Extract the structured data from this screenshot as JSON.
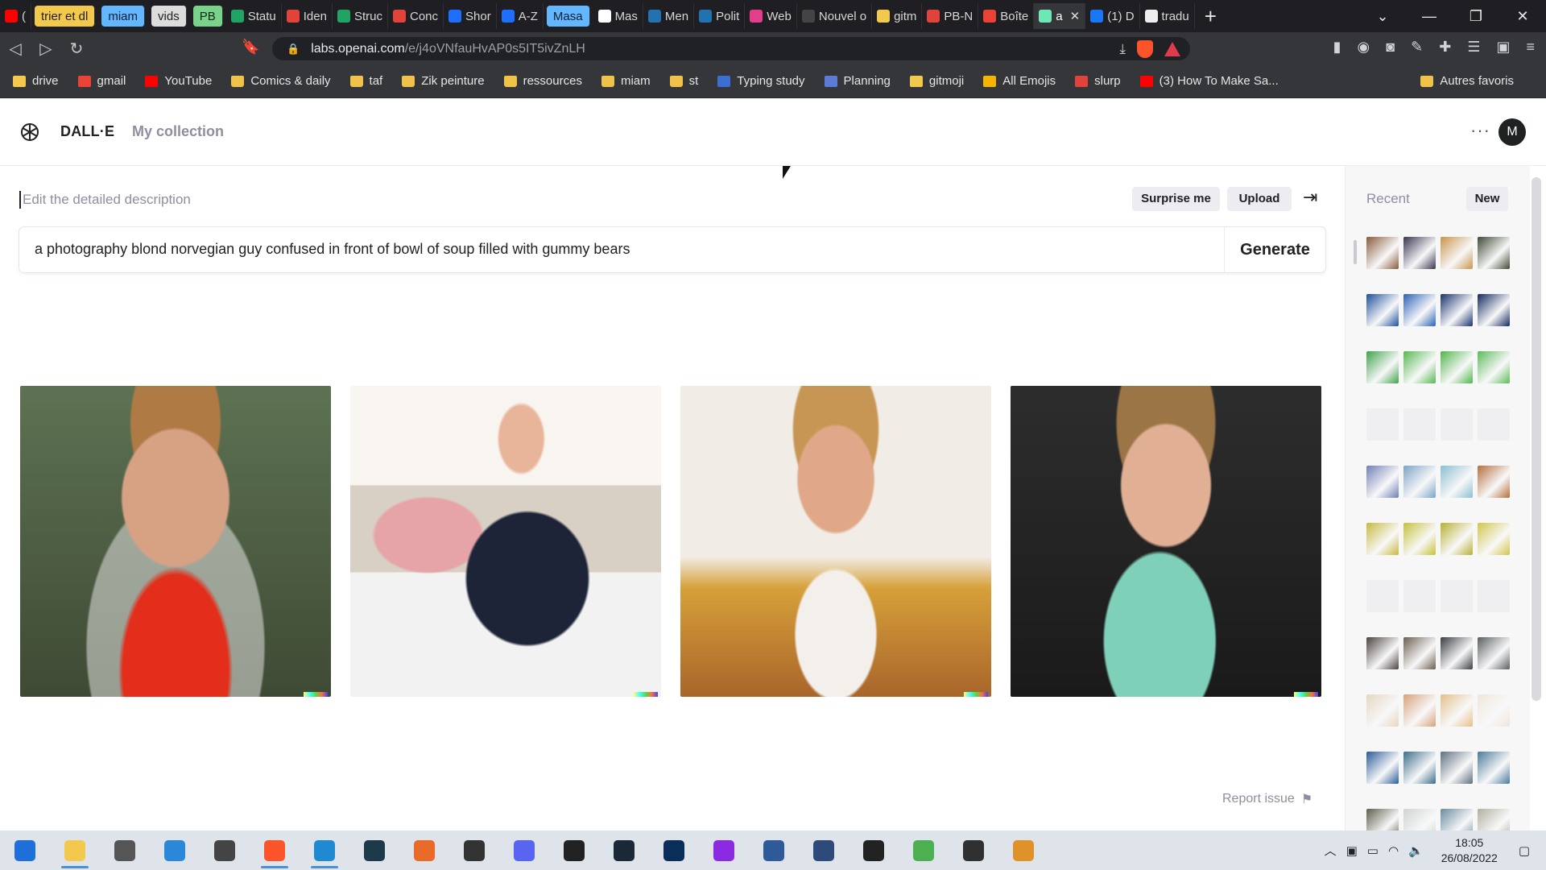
{
  "browser": {
    "tabs": [
      {
        "label": "(",
        "color": "#ff0000"
      },
      {
        "label": "trier et dl",
        "group": "yellow"
      },
      {
        "label": "miam",
        "group": "blue"
      },
      {
        "label": "vids",
        "group": "white"
      },
      {
        "label": "PB",
        "group": "green"
      },
      {
        "label": "Statu",
        "color": "#1fa463"
      },
      {
        "label": "Iden",
        "color": "#e0433a"
      },
      {
        "label": "Struc",
        "color": "#1fa463"
      },
      {
        "label": "Conc",
        "color": "#e0433a"
      },
      {
        "label": "Shor",
        "color": "#1e6fff"
      },
      {
        "label": "A-Z",
        "color": "#1e6fff"
      },
      {
        "label": "Masa",
        "group": "blue"
      },
      {
        "label": "Mas",
        "color": "#ffffff"
      },
      {
        "label": "Men",
        "color": "#2271b1"
      },
      {
        "label": "Polit",
        "color": "#2271b1"
      },
      {
        "label": "Web",
        "color": "#e33e8c"
      },
      {
        "label": "Nouvel o",
        "color": "#444"
      },
      {
        "label": "gitm",
        "color": "#f2c94c"
      },
      {
        "label": "PB-N",
        "color": "#e0433a"
      },
      {
        "label": "Boîte",
        "color": "#ea4335"
      },
      {
        "label": "a",
        "color": "#6ee7b7",
        "active": true
      },
      {
        "label": "(1) D",
        "color": "#1877f2"
      },
      {
        "label": "tradu",
        "color": "#eeeeee"
      }
    ],
    "url_host": "labs.openai.com",
    "url_path": "/e/j4oVNfauHvAP0s5IT5ivZnLH",
    "bookmarks": [
      {
        "label": "drive",
        "color": "#f2c94c"
      },
      {
        "label": "gmail",
        "color": "#ea4335"
      },
      {
        "label": "YouTube",
        "color": "#ff0000"
      },
      {
        "label": "Comics & daily",
        "folder": true
      },
      {
        "label": "taf",
        "folder": true
      },
      {
        "label": "Zik peinture",
        "folder": true
      },
      {
        "label": "ressources",
        "folder": true
      },
      {
        "label": "miam",
        "folder": true
      },
      {
        "label": "st",
        "folder": true
      },
      {
        "label": "Typing study",
        "color": "#3b6fd1"
      },
      {
        "label": "Planning",
        "color": "#5b7bd6"
      },
      {
        "label": "gitmoji",
        "color": "#f2c94c"
      },
      {
        "label": "All Emojis",
        "color": "#f4b400"
      },
      {
        "label": "slurp",
        "color": "#e0433a"
      },
      {
        "label": "(3) How To Make Sa...",
        "color": "#ff0000"
      }
    ],
    "other_bookmarks": "Autres favoris"
  },
  "app": {
    "brand": "DALL·E",
    "nav_collection": "My collection",
    "avatar_initial": "M"
  },
  "editor": {
    "hint": "Edit the detailed description",
    "surprise_label": "Surprise me",
    "upload_label": "Upload",
    "prompt": "a photography blond norvegian guy confused in front of bowl of soup filled with gummy bears",
    "generate_label": "Generate",
    "images": [
      {
        "name": "result-image-1"
      },
      {
        "name": "result-image-2"
      },
      {
        "name": "result-image-3"
      },
      {
        "name": "result-image-4"
      }
    ],
    "report_label": "Report issue"
  },
  "sidebar": {
    "title": "Recent",
    "new_label": "New",
    "thumb_colors": [
      "#8a5a3a",
      "#3a3450",
      "#c9944a",
      "#3f4a34",
      "#1c4f9c",
      "#2a62b7",
      "#17326e",
      "#122a5e",
      "#3fa34a",
      "#57b852",
      "#4fb64a",
      "#5dbb5a",
      "empty",
      "empty",
      "empty",
      "empty",
      "#6f7fb4",
      "#7aa4c8",
      "#8abfd0",
      "#b4703e",
      "#c7b93e",
      "#c6c13a",
      "#b8b032",
      "#d1c54a",
      "empty",
      "empty",
      "empty",
      "empty",
      "#4b4340",
      "#6a5e50",
      "#3a3c40",
      "#5a5e60",
      "#e6d6c0",
      "#d7a27a",
      "#e4c08a",
      "#efe6da",
      "#2a5c9a",
      "#3a6e8a",
      "#5e7080",
      "#4a7a9a",
      "#5e5e4a",
      "#cfd3cf",
      "#6a8aa0",
      "#b0b0a0"
    ]
  },
  "taskbar": {
    "apps": [
      {
        "name": "windows-start-icon",
        "color": "#1e6fd9"
      },
      {
        "name": "file-explorer-icon",
        "color": "#f2c94c",
        "running": true
      },
      {
        "name": "settings-icon",
        "color": "#555"
      },
      {
        "name": "blue-app-icon",
        "color": "#2b88d8"
      },
      {
        "name": "system-tool-icon",
        "color": "#444"
      },
      {
        "name": "brave-browser-icon",
        "color": "#fb542b",
        "running": true
      },
      {
        "name": "vscode-icon",
        "color": "#1f8ad2",
        "running": true
      },
      {
        "name": "tool-icon",
        "color": "#1c3a4a"
      },
      {
        "name": "orange-app-icon",
        "color": "#ea6a2a"
      },
      {
        "name": "files-icon",
        "color": "#333"
      },
      {
        "name": "discord-icon",
        "color": "#5865f2"
      },
      {
        "name": "epic-games-icon",
        "color": "#222"
      },
      {
        "name": "steam-icon",
        "color": "#1b2838"
      },
      {
        "name": "photoshop-icon",
        "color": "#0b2d5a"
      },
      {
        "name": "purple-circle-icon",
        "color": "#8a2be2"
      },
      {
        "name": "notes-icon",
        "color": "#2e5a9a"
      },
      {
        "name": "blue-circle-icon",
        "color": "#2d4a7a"
      },
      {
        "name": "skype-icon",
        "color": "#222"
      },
      {
        "name": "green-app-icon",
        "color": "#4caf50"
      },
      {
        "name": "obs-icon",
        "color": "#303030"
      },
      {
        "name": "paint-app-icon",
        "color": "#e0922a"
      }
    ],
    "time": "18:05",
    "date": "26/08/2022"
  }
}
